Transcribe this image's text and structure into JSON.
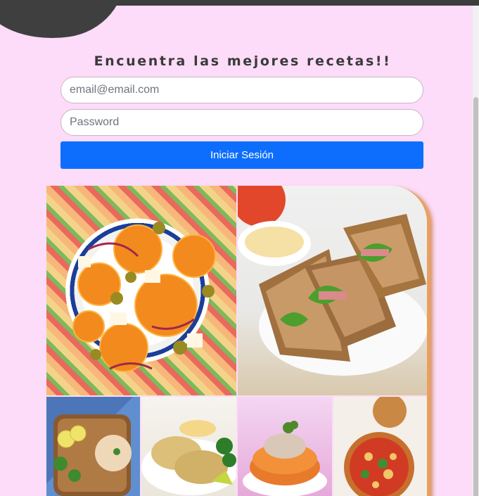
{
  "heading": "Encuentra las mejores recetas!!",
  "login": {
    "email_placeholder": "email@email.com",
    "password_placeholder": "Password",
    "submit_label": "Iniciar Sesión"
  },
  "gallery": {
    "images": [
      "orange-salad-photo",
      "sandwich-photo",
      "flatbread-photo",
      "potato-cakes-photo",
      "tuna-toast-photo",
      "pizza-photo"
    ]
  },
  "colors": {
    "background": "#fcdcf8",
    "button": "#0d6efd",
    "heading": "#3a3a3a"
  }
}
